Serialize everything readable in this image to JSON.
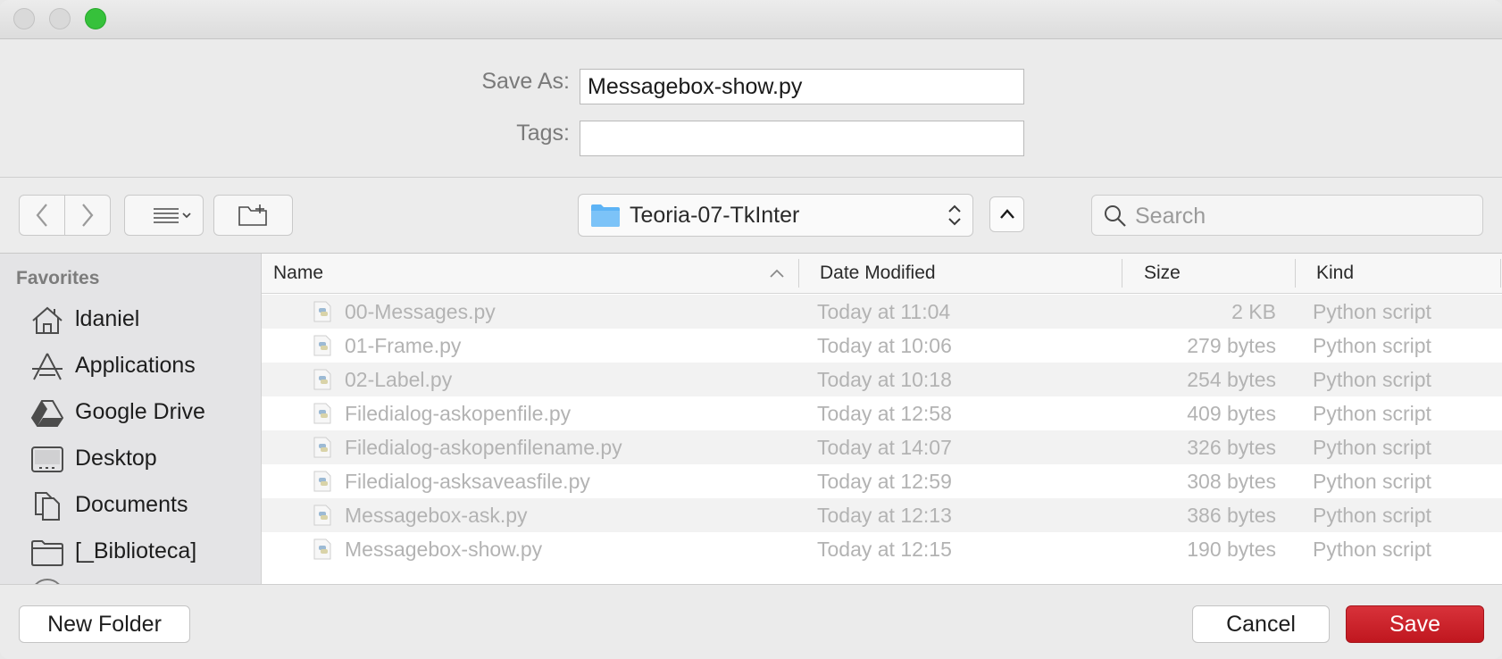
{
  "save_as": {
    "label": "Save As:",
    "value": "Messagebox-show.py"
  },
  "tags": {
    "label": "Tags:",
    "value": ""
  },
  "toolbar": {
    "location": "Teoria-07-TkInter",
    "search_placeholder": "Search"
  },
  "sidebar": {
    "section_title": "Favorites",
    "items": [
      {
        "label": "ldaniel",
        "icon": "home-icon"
      },
      {
        "label": "Applications",
        "icon": "applications-icon"
      },
      {
        "label": "Google Drive",
        "icon": "google-drive-icon"
      },
      {
        "label": "Desktop",
        "icon": "desktop-icon"
      },
      {
        "label": "Documents",
        "icon": "documents-icon"
      },
      {
        "label": "[_Biblioteca]",
        "icon": "folder-icon"
      }
    ]
  },
  "file_list": {
    "columns": [
      "Name",
      "Date Modified",
      "Size",
      "Kind"
    ],
    "sort": {
      "column": "Name",
      "direction": "ascending"
    },
    "rows": [
      {
        "name": "00-Messages.py",
        "date": "Today at 11:04",
        "size": "2 KB",
        "kind": "Python script"
      },
      {
        "name": "01-Frame.py",
        "date": "Today at 10:06",
        "size": "279 bytes",
        "kind": "Python script"
      },
      {
        "name": "02-Label.py",
        "date": "Today at 10:18",
        "size": "254 bytes",
        "kind": "Python script"
      },
      {
        "name": "Filedialog-askopenfile.py",
        "date": "Today at 12:58",
        "size": "409 bytes",
        "kind": "Python script"
      },
      {
        "name": "Filedialog-askopenfilename.py",
        "date": "Today at 14:07",
        "size": "326 bytes",
        "kind": "Python script"
      },
      {
        "name": "Filedialog-asksaveasfile.py",
        "date": "Today at 12:59",
        "size": "308 bytes",
        "kind": "Python script"
      },
      {
        "name": "Messagebox-ask.py",
        "date": "Today at 12:13",
        "size": "386 bytes",
        "kind": "Python script"
      },
      {
        "name": "Messagebox-show.py",
        "date": "Today at 12:15",
        "size": "190 bytes",
        "kind": "Python script"
      }
    ]
  },
  "buttons": {
    "new_folder": "New Folder",
    "cancel": "Cancel",
    "save": "Save"
  },
  "colors": {
    "save_button": "#c9202a",
    "window_zoom": "#36c13b",
    "folder_blue": "#4aa6f0"
  }
}
